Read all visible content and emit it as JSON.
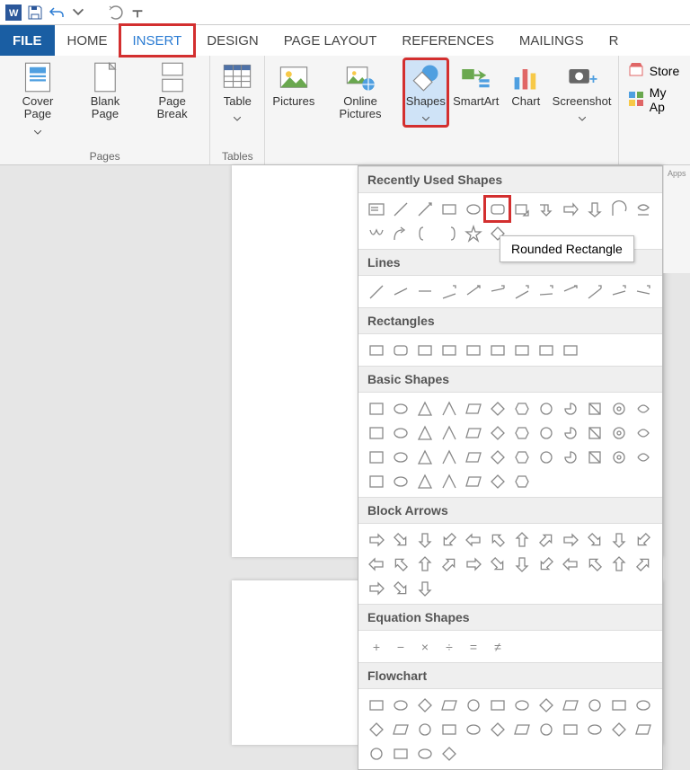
{
  "title_bar": {
    "app": "Word"
  },
  "tabs": {
    "file": "FILE",
    "home": "HOME",
    "insert": "INSERT",
    "design": "DESIGN",
    "page_layout": "PAGE LAYOUT",
    "references": "REFERENCES",
    "mailings": "MAILINGS"
  },
  "ribbon": {
    "pages": {
      "label": "Pages",
      "cover_page": "Cover Page",
      "blank_page": "Blank Page",
      "page_break": "Page Break"
    },
    "tables": {
      "label": "Tables",
      "table": "Table"
    },
    "illustrations": {
      "pictures": "Pictures",
      "online_pictures": "Online Pictures",
      "shapes": "Shapes",
      "smartart": "SmartArt",
      "chart": "Chart",
      "screenshot": "Screenshot"
    },
    "store": {
      "store": "Store",
      "my_apps": "My Ap",
      "apps_frag": "Apps"
    }
  },
  "shapes_panel": {
    "tooltip": "Rounded Rectangle",
    "categories": [
      {
        "name": "Recently Used Shapes",
        "rows": [
          12,
          6
        ]
      },
      {
        "name": "Lines",
        "rows": [
          12
        ]
      },
      {
        "name": "Rectangles",
        "rows": [
          9
        ]
      },
      {
        "name": "Basic Shapes",
        "rows": [
          12,
          12,
          12,
          7
        ]
      },
      {
        "name": "Block Arrows",
        "rows": [
          12,
          12,
          3
        ]
      },
      {
        "name": "Equation Shapes",
        "rows": [
          6
        ]
      },
      {
        "name": "Flowchart",
        "rows": [
          12,
          12,
          4
        ]
      }
    ]
  }
}
